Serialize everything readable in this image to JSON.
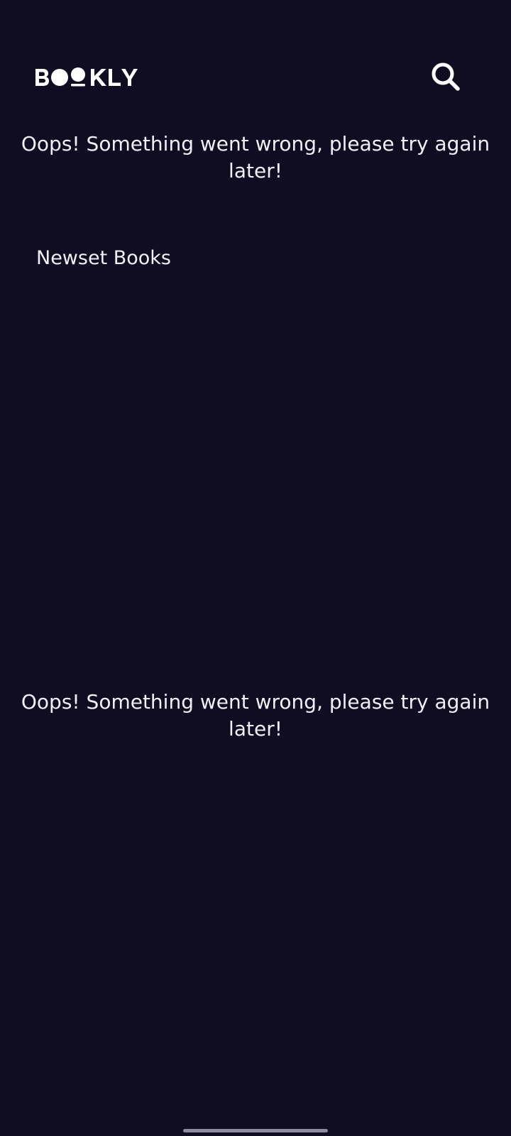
{
  "app": {
    "logo_text": "BOOKLY",
    "search_icon": "search-icon"
  },
  "messages": {
    "error_top": "Oops! Something went wrong, please try again later!",
    "error_bottom": "Oops! Something went wrong, please try again later!"
  },
  "sections": {
    "newest_books_title": "Newset Books"
  },
  "colors": {
    "background": "#100c21",
    "text": "#f2f0f7",
    "icon": "#ffffff"
  }
}
